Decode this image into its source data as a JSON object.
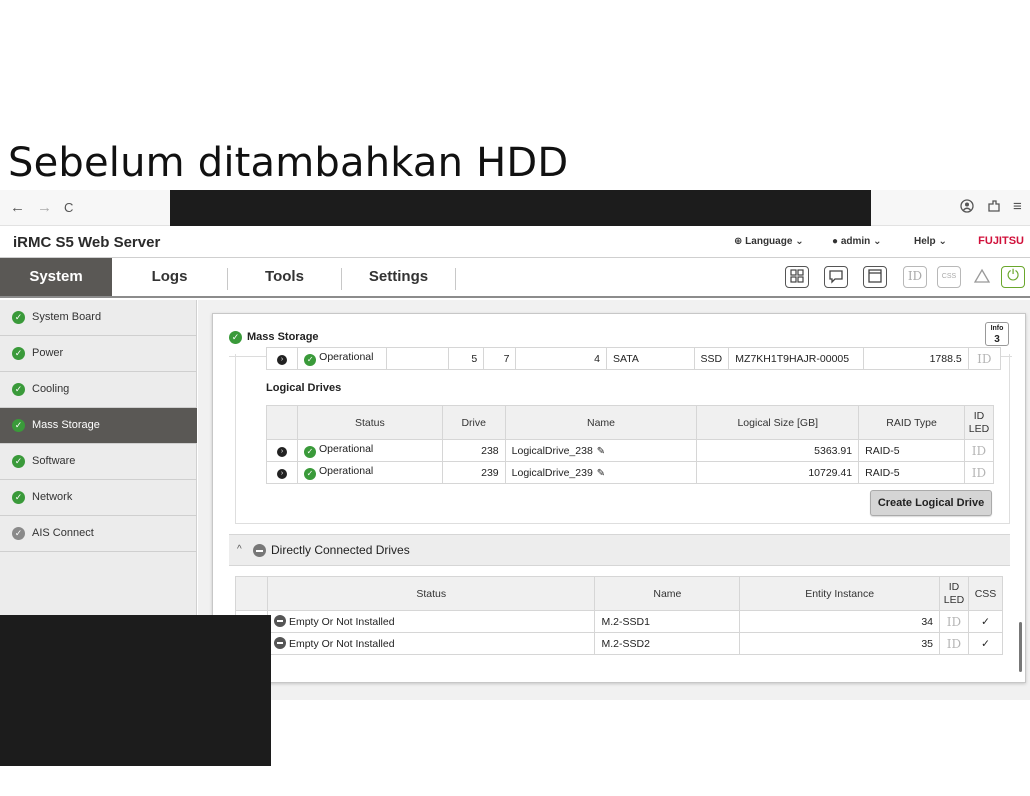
{
  "slide": {
    "title": "Sebelum ditambahkan HDD"
  },
  "browser": {
    "back": "←",
    "forward": "→",
    "reload": "C"
  },
  "header": {
    "app_title": "iRMC S5 Web Server",
    "language": "Language",
    "user": "admin",
    "help": "Help",
    "brand": "FUJITSU"
  },
  "tabs": [
    {
      "label": "System",
      "active": true
    },
    {
      "label": "Logs"
    },
    {
      "label": "Tools"
    },
    {
      "label": "Settings"
    }
  ],
  "toolbar": {
    "id_label": "ID",
    "css_label": "CSS"
  },
  "sidebar": {
    "items": [
      {
        "label": "System Board",
        "status": "ok"
      },
      {
        "label": "Power",
        "status": "ok"
      },
      {
        "label": "Cooling",
        "status": "ok"
      },
      {
        "label": "Mass Storage",
        "status": "ok",
        "active": true
      },
      {
        "label": "Software",
        "status": "ok"
      },
      {
        "label": "Network",
        "status": "ok"
      },
      {
        "label": "AIS Connect",
        "status": "neutral"
      }
    ]
  },
  "panel": {
    "title": "Mass Storage",
    "info_label": "Info",
    "info_count": "3",
    "partial_row": {
      "status": "Operational",
      "c1": "5",
      "c2": "7",
      "c3": "4",
      "interface": "SATA",
      "media": "SSD",
      "model": "MZ7KH1T9HAJR-00005",
      "size": "1788.5",
      "id_led": "ID"
    },
    "logical_drives": {
      "title": "Logical Drives",
      "columns": {
        "status": "Status",
        "drive": "Drive",
        "name": "Name",
        "size": "Logical Size [GB]",
        "raid": "RAID Type",
        "id_led": "ID LED"
      },
      "rows": [
        {
          "status": "Operational",
          "drive": "238",
          "name": "LogicalDrive_238",
          "size": "5363.91",
          "raid": "RAID-5",
          "id_led": "ID"
        },
        {
          "status": "Operational",
          "drive": "239",
          "name": "LogicalDrive_239",
          "size": "10729.41",
          "raid": "RAID-5",
          "id_led": "ID"
        }
      ],
      "create_button": "Create Logical Drive"
    },
    "direct": {
      "title": "Directly Connected Drives",
      "columns": {
        "status": "Status",
        "name": "Name",
        "entity": "Entity Instance",
        "id_led": "ID LED",
        "css": "CSS"
      },
      "rows": [
        {
          "status": "Empty Or Not Installed",
          "name": "M.2-SSD1",
          "entity": "34",
          "id_led": "ID",
          "css": "✓"
        },
        {
          "status": "Empty Or Not Installed",
          "name": "M.2-SSD2",
          "entity": "35",
          "id_led": "ID",
          "css": "✓"
        }
      ]
    }
  }
}
